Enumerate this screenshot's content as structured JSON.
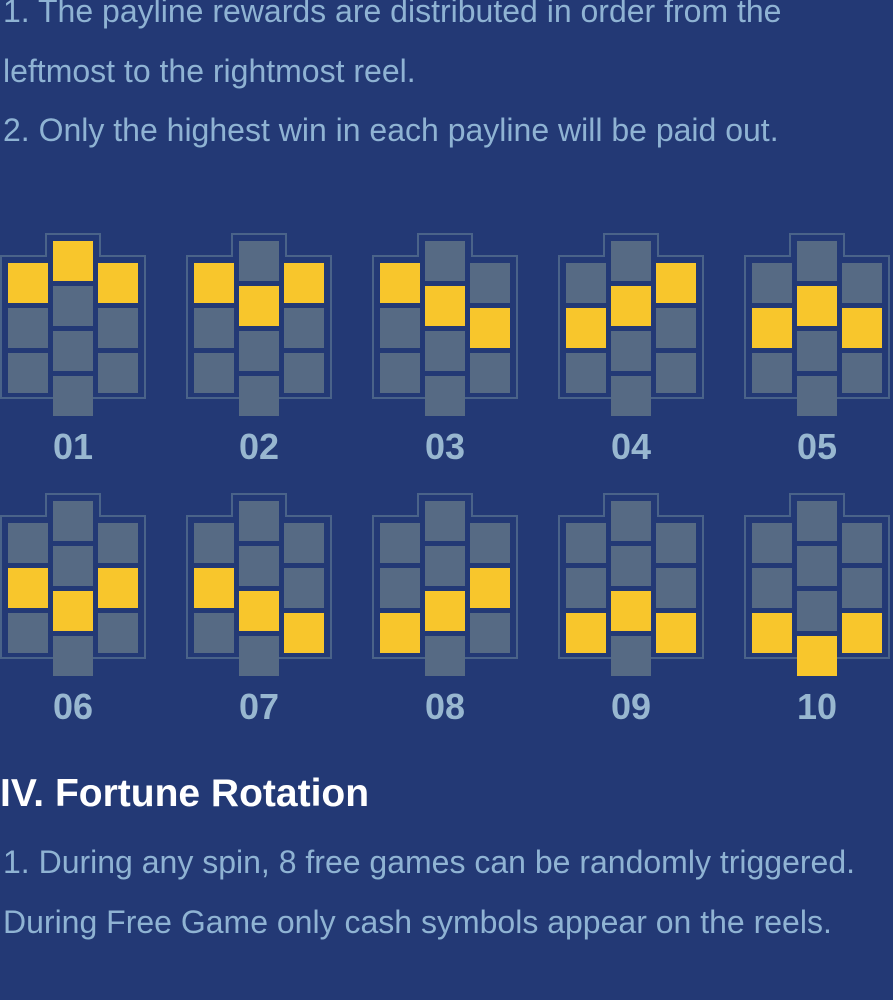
{
  "rules": {
    "payline_rule_1": "1. The payline rewards are distributed in order from the leftmost to the rightmost reel.",
    "payline_rule_2": "2. Only the highest win in each payline will be paid out."
  },
  "section": {
    "title": "IV. Fortune Rotation",
    "rule_1": "1. During any spin, 8 free games can be randomly triggered. During Free Game only cash symbols appear on the reels."
  },
  "paylines": [
    {
      "label": "01",
      "highlight": [
        [
          0,
          0
        ],
        [
          1,
          0
        ],
        [
          2,
          0
        ]
      ]
    },
    {
      "label": "02",
      "highlight": [
        [
          0,
          0
        ],
        [
          1,
          1
        ],
        [
          2,
          0
        ]
      ]
    },
    {
      "label": "03",
      "highlight": [
        [
          0,
          0
        ],
        [
          1,
          1
        ],
        [
          2,
          1
        ]
      ]
    },
    {
      "label": "04",
      "highlight": [
        [
          0,
          1
        ],
        [
          1,
          1
        ],
        [
          2,
          0
        ]
      ]
    },
    {
      "label": "05",
      "highlight": [
        [
          0,
          1
        ],
        [
          1,
          1
        ],
        [
          2,
          1
        ]
      ]
    },
    {
      "label": "06",
      "highlight": [
        [
          0,
          1
        ],
        [
          1,
          2
        ],
        [
          2,
          1
        ]
      ]
    },
    {
      "label": "07",
      "highlight": [
        [
          0,
          1
        ],
        [
          1,
          2
        ],
        [
          2,
          2
        ]
      ]
    },
    {
      "label": "08",
      "highlight": [
        [
          0,
          2
        ],
        [
          1,
          2
        ],
        [
          2,
          1
        ]
      ]
    },
    {
      "label": "09",
      "highlight": [
        [
          0,
          2
        ],
        [
          1,
          2
        ],
        [
          2,
          2
        ]
      ]
    },
    {
      "label": "10",
      "highlight": [
        [
          0,
          2
        ],
        [
          1,
          3
        ],
        [
          2,
          2
        ]
      ]
    }
  ],
  "colors": {
    "background": "#233975",
    "cell": "#566a84",
    "highlight": "#f8c62c",
    "frame": "#4a6389"
  }
}
